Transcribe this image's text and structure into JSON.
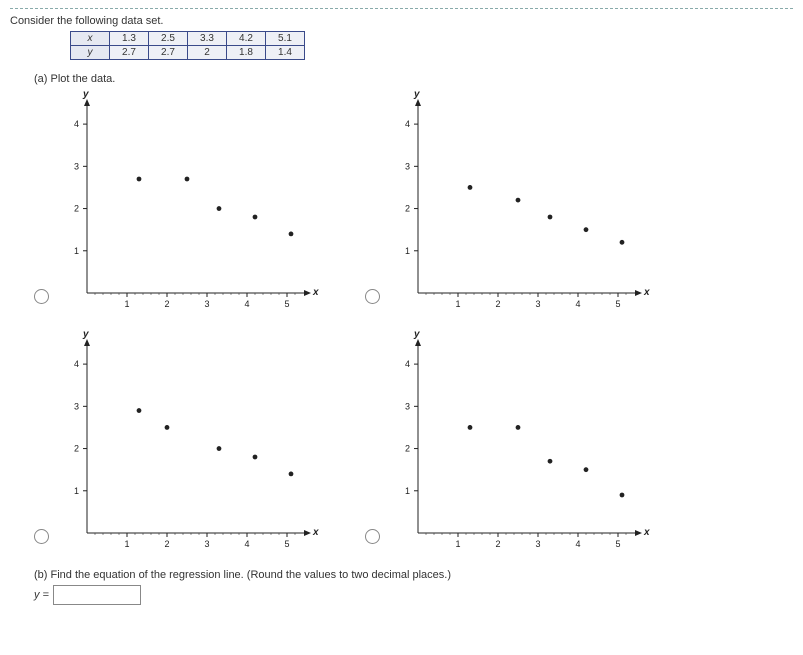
{
  "intro": "Consider the following data set.",
  "table": {
    "row1_hdr": "x",
    "row2_hdr": "y",
    "x": [
      "1.3",
      "2.5",
      "3.3",
      "4.2",
      "5.1"
    ],
    "y": [
      "2.7",
      "2.7",
      "2",
      "1.8",
      "1.4"
    ]
  },
  "partA_label": "(a) Plot the data.",
  "axis": {
    "y": "y",
    "x": "x",
    "ticks_x": [
      "1",
      "2",
      "3",
      "4",
      "5"
    ],
    "ticks_y": [
      "1",
      "2",
      "3",
      "4"
    ]
  },
  "partB_label": "(b) Find the equation of the regression line. (Round the values to two decimal places.)",
  "partB_var": "y =",
  "answer_placeholder": "",
  "chart_data": [
    {
      "type": "scatter",
      "title": "Option A",
      "xlabel": "x",
      "ylabel": "y",
      "xlim": [
        0,
        5.5
      ],
      "ylim": [
        0,
        4.5
      ],
      "series": [
        {
          "name": "pts",
          "x": [
            1.3,
            2.5,
            3.3,
            4.2,
            5.1
          ],
          "y": [
            2.7,
            2.7,
            2.0,
            1.8,
            1.4
          ]
        }
      ]
    },
    {
      "type": "scatter",
      "title": "Option B",
      "xlabel": "x",
      "ylabel": "y",
      "xlim": [
        0,
        5.5
      ],
      "ylim": [
        0,
        4.5
      ],
      "series": [
        {
          "name": "pts",
          "x": [
            1.3,
            2.5,
            3.3,
            4.2,
            5.1
          ],
          "y": [
            2.5,
            2.2,
            1.8,
            1.5,
            1.2
          ]
        }
      ]
    },
    {
      "type": "scatter",
      "title": "Option C",
      "xlabel": "x",
      "ylabel": "y",
      "xlim": [
        0,
        5.5
      ],
      "ylim": [
        0,
        4.5
      ],
      "series": [
        {
          "name": "pts",
          "x": [
            1.3,
            2.0,
            3.3,
            4.2,
            5.1
          ],
          "y": [
            2.9,
            2.5,
            2.0,
            1.8,
            1.4
          ]
        }
      ]
    },
    {
      "type": "scatter",
      "title": "Option D",
      "xlabel": "x",
      "ylabel": "y",
      "xlim": [
        0,
        5.5
      ],
      "ylim": [
        0,
        4.5
      ],
      "series": [
        {
          "name": "pts",
          "x": [
            1.3,
            2.5,
            3.3,
            4.2,
            5.1
          ],
          "y": [
            2.5,
            2.5,
            1.7,
            1.5,
            0.9
          ]
        }
      ]
    }
  ]
}
